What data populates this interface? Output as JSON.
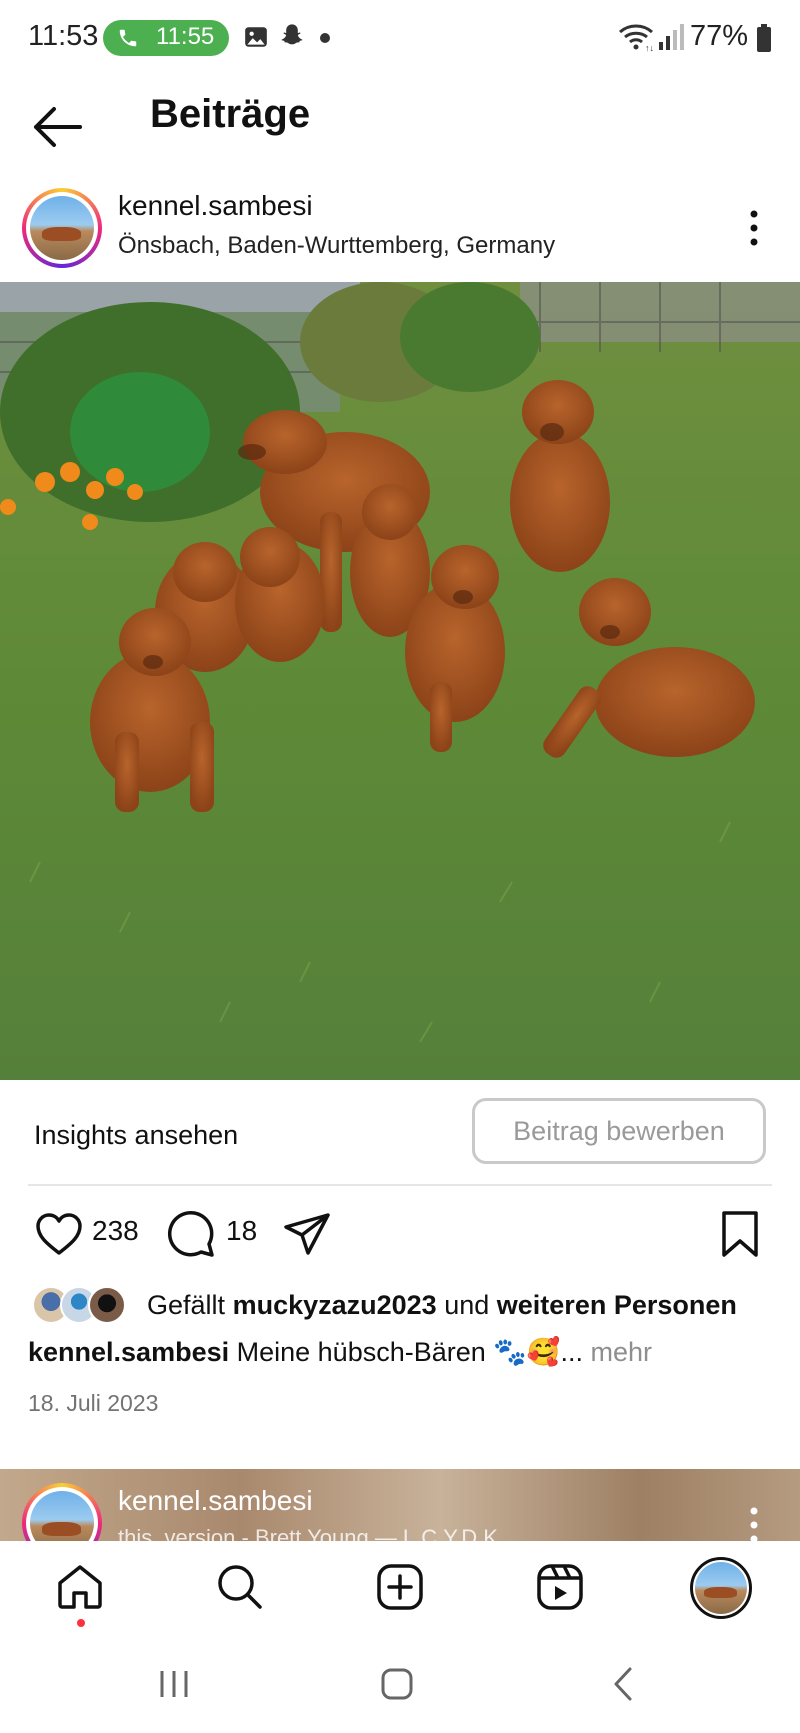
{
  "status_bar": {
    "time": "11:53",
    "call_time": "11:55",
    "battery": "77%"
  },
  "header": {
    "title": "Beiträge"
  },
  "post": {
    "username": "kennel.sambesi",
    "location": "Önsbach, Baden-Wurttemberg, Germany",
    "insights_label": "Insights ansehen",
    "promote_label": "Beitrag bewerben",
    "likes_count": "238",
    "comments_count": "18",
    "likes_prefix": "Gefällt",
    "liker_name": "muckyzazu2023",
    "likes_mid": "und",
    "likes_suffix": "weiteren Personen",
    "caption_user": "kennel.sambesi",
    "caption_text": "Meine hübsch-Bären 🐾🥰...",
    "caption_more": " mehr",
    "date": "18. Juli 2023"
  },
  "next_post": {
    "username": "kennel.sambesi",
    "subtitle": "this_version - Brett Young — L.C.Y.D.K."
  },
  "icons": {
    "status": [
      "call-icon",
      "gallery-icon",
      "snapchat-icon",
      "dot-icon",
      "wifi-icon",
      "signal-icon",
      "battery-icon"
    ],
    "header": [
      "back-arrow-icon"
    ],
    "actions": [
      "heart-icon",
      "comment-icon",
      "share-icon",
      "bookmark-icon"
    ],
    "nav": [
      "home-icon",
      "search-icon",
      "create-icon",
      "reels-icon",
      "profile-avatar"
    ],
    "system": [
      "recent-apps-icon",
      "home-button-icon",
      "back-icon"
    ]
  },
  "colors": {
    "call_pill": "#4caf50",
    "notification_dot": "#ff3040",
    "secondary_text": "#737373"
  }
}
